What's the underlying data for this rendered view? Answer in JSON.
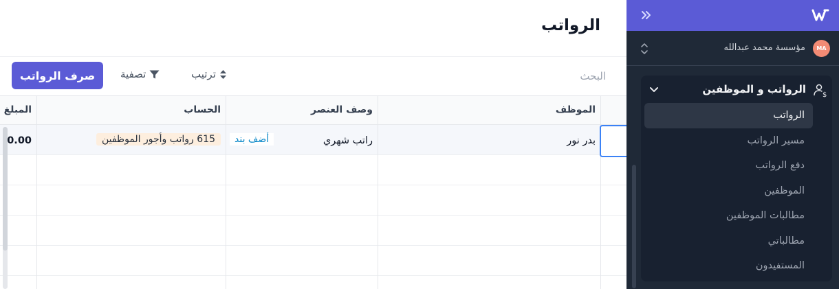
{
  "sidebar": {
    "org_initials": "MA",
    "org_name": "مؤسسة محمد عبدالله",
    "group_title": "الرواتب و الموظفين",
    "items": [
      {
        "label": "الرواتب",
        "active": true
      },
      {
        "label": "مسير الرواتب",
        "active": false
      },
      {
        "label": "دفع الرواتب",
        "active": false
      },
      {
        "label": "الموظفين",
        "active": false
      },
      {
        "label": "مطالبات الموظفين",
        "active": false
      },
      {
        "label": "مطالباتي",
        "active": false
      },
      {
        "label": "المستفيدون",
        "active": false
      }
    ]
  },
  "header": {
    "title": "الرواتب"
  },
  "toolbar": {
    "search_placeholder": "البحث",
    "sort_label": "ترتيب",
    "filter_label": "تصفية",
    "pay_label": "صرف الرواتب"
  },
  "table": {
    "columns": {
      "employee": "الموظف",
      "item_desc": "وصف العنصر",
      "account": "الحساب",
      "amount": "المبلغ"
    },
    "rows": [
      {
        "employee": "بدر نور",
        "item_desc": "راتب شهري",
        "add_item": "أضف بند",
        "account": "615 رواتب وأجور الموظفين",
        "amount": "0.00"
      }
    ]
  },
  "colors": {
    "brand": "#5b5bd6",
    "sidebar_bg": "#1f2937",
    "focus": "#3b82f6",
    "tag_bg": "#fdeede",
    "link": "#0284c7"
  }
}
